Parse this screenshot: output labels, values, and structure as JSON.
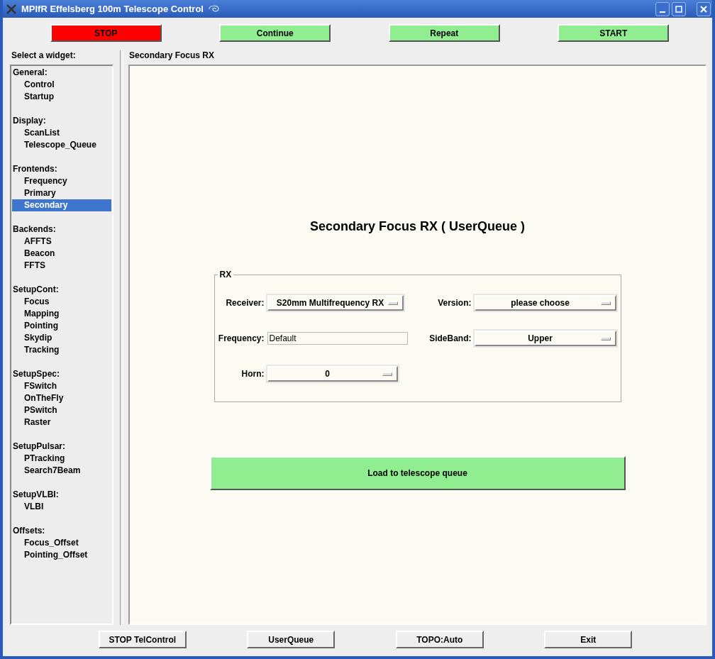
{
  "window": {
    "title": "MPIfR Effelsberg 100m Telescope Control"
  },
  "top_buttons": [
    {
      "label": "STOP",
      "color": "#ff0000"
    },
    {
      "label": "Continue",
      "color": "#90ee90"
    },
    {
      "label": "Repeat",
      "color": "#90ee90"
    },
    {
      "label": "START",
      "color": "#90ee90"
    }
  ],
  "sidebar": {
    "title": "Select a widget:",
    "groups": [
      {
        "label": "General:",
        "items": [
          {
            "label": "Control",
            "selected": false
          },
          {
            "label": "Startup",
            "selected": false
          }
        ]
      },
      {
        "label": "Display:",
        "items": [
          {
            "label": "ScanList",
            "selected": false
          },
          {
            "label": "Telescope_Queue",
            "selected": false
          }
        ]
      },
      {
        "label": "Frontends:",
        "items": [
          {
            "label": "Frequency",
            "selected": false
          },
          {
            "label": "Primary",
            "selected": false
          },
          {
            "label": "Secondary",
            "selected": true
          }
        ]
      },
      {
        "label": "Backends:",
        "items": [
          {
            "label": "AFFTS",
            "selected": false
          },
          {
            "label": "Beacon",
            "selected": false
          },
          {
            "label": "FFTS",
            "selected": false
          }
        ]
      },
      {
        "label": "SetupCont:",
        "items": [
          {
            "label": "Focus",
            "selected": false
          },
          {
            "label": "Mapping",
            "selected": false
          },
          {
            "label": "Pointing",
            "selected": false
          },
          {
            "label": "Skydip",
            "selected": false
          },
          {
            "label": "Tracking",
            "selected": false
          }
        ]
      },
      {
        "label": "SetupSpec:",
        "items": [
          {
            "label": "FSwitch",
            "selected": false
          },
          {
            "label": "OnTheFly",
            "selected": false
          },
          {
            "label": "PSwitch",
            "selected": false
          },
          {
            "label": "Raster",
            "selected": false
          }
        ]
      },
      {
        "label": "SetupPulsar:",
        "items": [
          {
            "label": "PTracking",
            "selected": false
          },
          {
            "label": "Search7Beam",
            "selected": false
          }
        ]
      },
      {
        "label": "SetupVLBI:",
        "items": [
          {
            "label": "VLBI",
            "selected": false
          }
        ]
      },
      {
        "label": "Offsets:",
        "items": [
          {
            "label": "Focus_Offset",
            "selected": false
          },
          {
            "label": "Pointing_Offset",
            "selected": false
          }
        ]
      }
    ]
  },
  "panel": {
    "title": "Secondary Focus RX",
    "heading": "Secondary Focus RX ( UserQueue )",
    "group": {
      "title": "RX",
      "rows": [
        [
          {
            "label": "Receiver:",
            "kind": "dropdown",
            "value": "S20mm Multifrequency RX"
          },
          {
            "label": "Version:",
            "kind": "dropdown",
            "value": "please choose"
          }
        ],
        [
          {
            "label": "Frequency:",
            "kind": "input",
            "value": "Default"
          },
          {
            "label": "SideBand:",
            "kind": "dropdown",
            "value": "Upper"
          }
        ],
        [
          {
            "label": "Horn:",
            "kind": "dropdown",
            "value": "0"
          }
        ]
      ]
    },
    "action": "Load to telescope queue"
  },
  "bottom_buttons": [
    "STOP TelControl",
    "UserQueue",
    "TOPO:Auto",
    "Exit"
  ]
}
